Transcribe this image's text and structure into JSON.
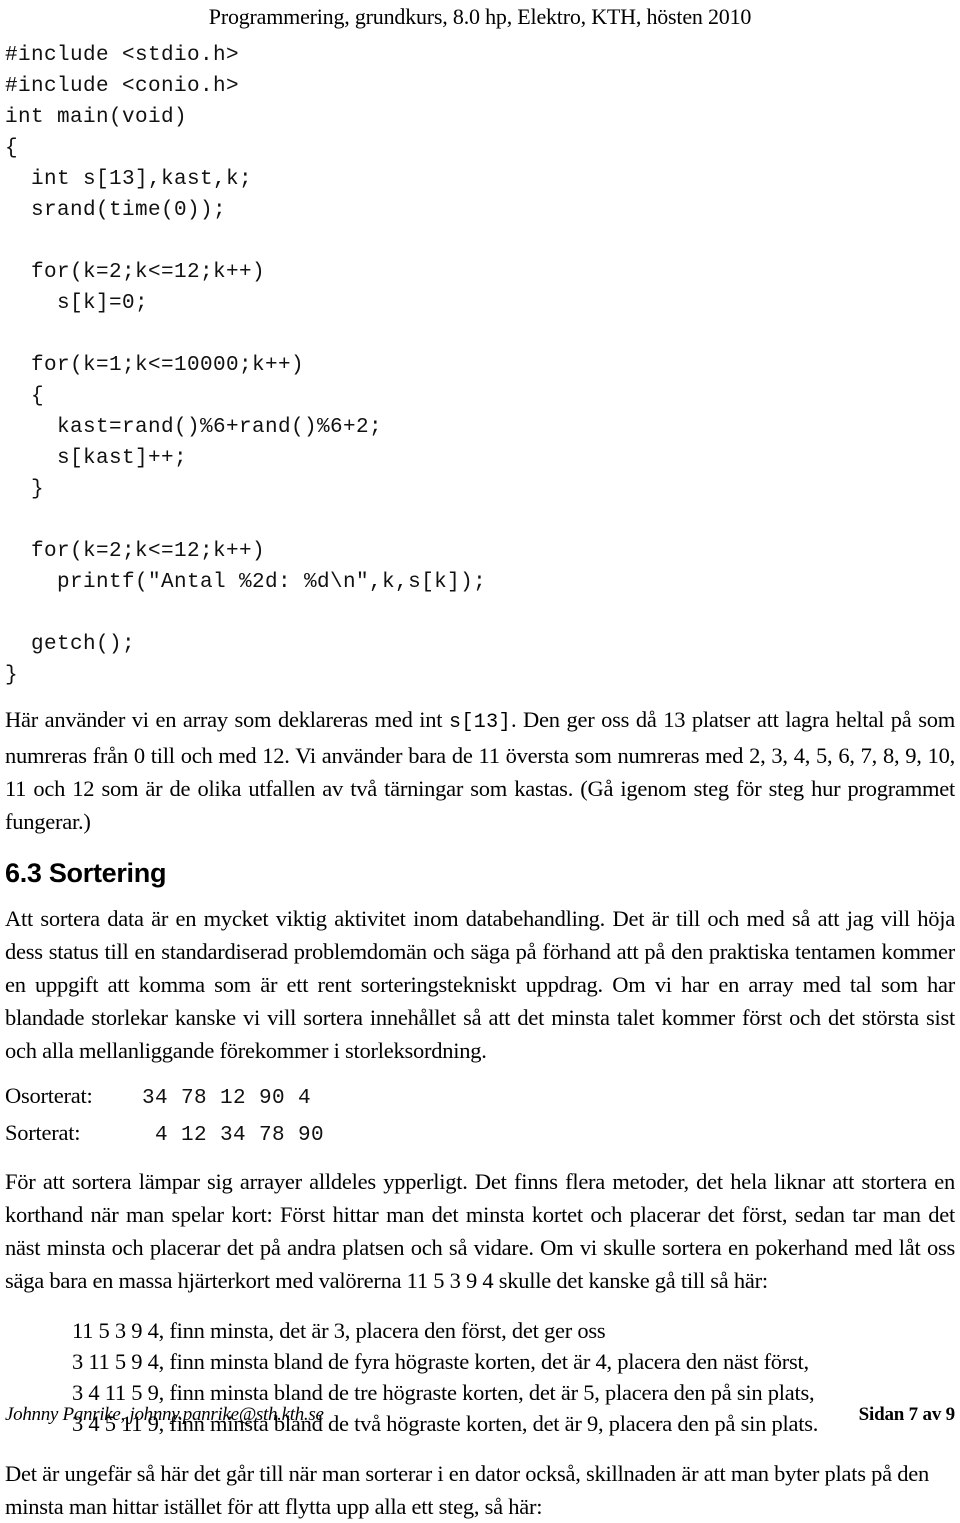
{
  "header": {
    "running_title": "Programmering, grundkurs, 8.0 hp, Elektro, KTH, hösten 2010"
  },
  "code_listing": "#include <stdio.h>\n#include <conio.h>\nint main(void)\n{\n  int s[13],kast,k;\n  srand(time(0));\n\n  for(k=2;k<=12;k++)\n    s[k]=0;\n\n  for(k=1;k<=10000;k++)\n  {\n    kast=rand()%6+rand()%6+2;\n    s[kast]++;\n  }\n\n  for(k=2;k<=12;k++)\n    printf(\"Antal %2d: %d\\n\",k,s[k]);\n\n  getch();\n}",
  "paragraphs": {
    "array_explanation_part1": "Här använder vi en array som deklareras med int ",
    "array_explanation_code": "s[13]",
    "array_explanation_part2": ". Den ger oss då 13 platser att lagra heltal på som numreras från 0 till och med 12. Vi använder bara de 11 översta som numreras med 2, 3, 4, 5, 6, 7, 8, 9, 10, 11 och 12 som är de olika utfallen av två tärningar som kastas. (Gå igenom steg för steg hur programmet fungerar.)",
    "sorting_intro": "Att sortera data är en mycket viktig aktivitet inom databehandling. Det är till och med så att jag vill höja dess status till en standardiserad problemdomän och säga på förhand att på den praktiska tentamen kommer en uppgift att komma som är ett rent sorteringstekniskt uppdrag. Om vi har en array med tal som har blandade storlekar kanske vi vill sortera innehållet så att det minsta talet kommer först och det största sist och alla mellanliggande förekommer i storleksordning.",
    "arrays_suitable": "För att sortera lämpar sig arrayer alldeles ypperligt. Det finns flera metoder, det hela liknar att stortera en korthand när man spelar kort: Först hittar man det minsta kortet och placerar det först, sedan tar man det näst minsta och placerar det på andra platsen och så vidare. Om vi skulle sortera en pokerhand med låt oss säga bara en massa hjärterkort med valörerna 11 5 3 9 4 skulle det kanske gå till så här:",
    "closing": "Det är ungefär så här det går till när man sorterar i en dator också, skillnaden är att man byter plats på den minsta man hittar istället för att flytta upp alla ett steg, så här:"
  },
  "section": {
    "number_and_title": "6.3 Sortering"
  },
  "samples": [
    {
      "label": "Osorterat:",
      "values": "34 78 12 90 4"
    },
    {
      "label": "Sorterat:",
      "values": " 4 12 34 78 90"
    }
  ],
  "steps": [
    "11 5 3 9 4, finn minsta, det är 3, placera den först, det ger oss",
    "3 11 5 9 4, finn minsta bland de fyra högraste korten, det är 4, placera den näst först,",
    "3 4 11 5 9, finn minsta bland de tre högraste korten, det är 5, placera den på sin plats,",
    "3 4 5 11 9, finn minsta bland de två högraste korten, det är 9, placera den på sin plats."
  ],
  "footer": {
    "author_contact": "Johnny Panrike, johnny.panrike@sth.kth.se",
    "page_number": "Sidan 7 av 9"
  }
}
